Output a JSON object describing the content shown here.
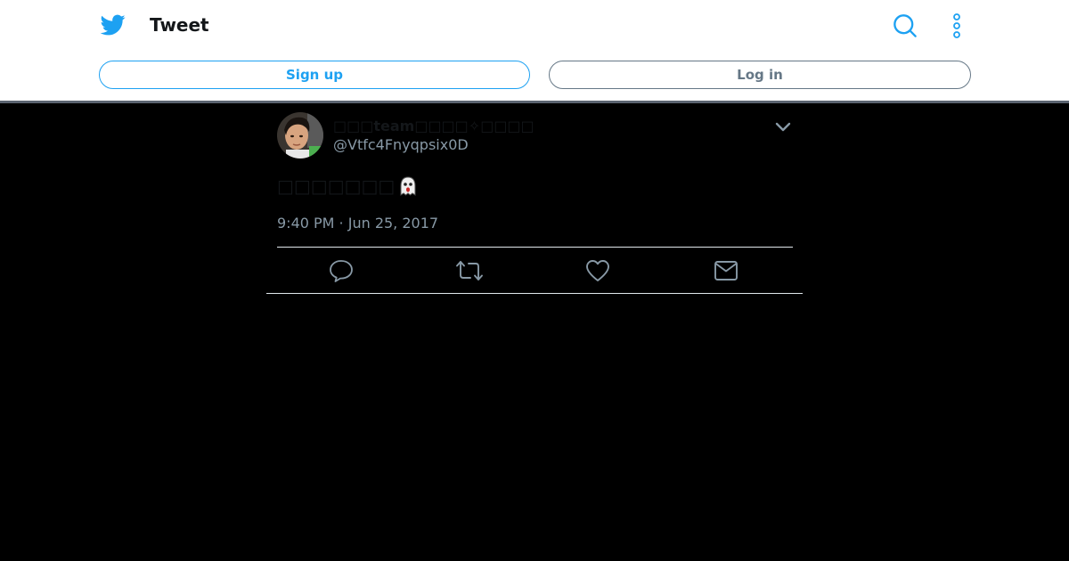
{
  "header": {
    "title": "Tweet",
    "logo_icon": "twitter-bird-icon",
    "search_icon": "search-icon",
    "more_icon": "more-vertical-icon",
    "signup_label": "Sign up",
    "login_label": "Log in"
  },
  "tweet": {
    "display_name": "□□□team□□□□✧□□□□",
    "handle": "@Vtfc4Fnyqpsix0D",
    "text": "□□□□□□□",
    "emoji": "ghost-emoji",
    "timestamp": "9:40 PM · Jun 25, 2017",
    "actions": [
      "reply-icon",
      "retweet-icon",
      "like-icon",
      "message-icon"
    ]
  },
  "colors": {
    "brand": "#1da1f2",
    "muted": "#8899a6",
    "text": "#14171a",
    "background": "#000000"
  }
}
